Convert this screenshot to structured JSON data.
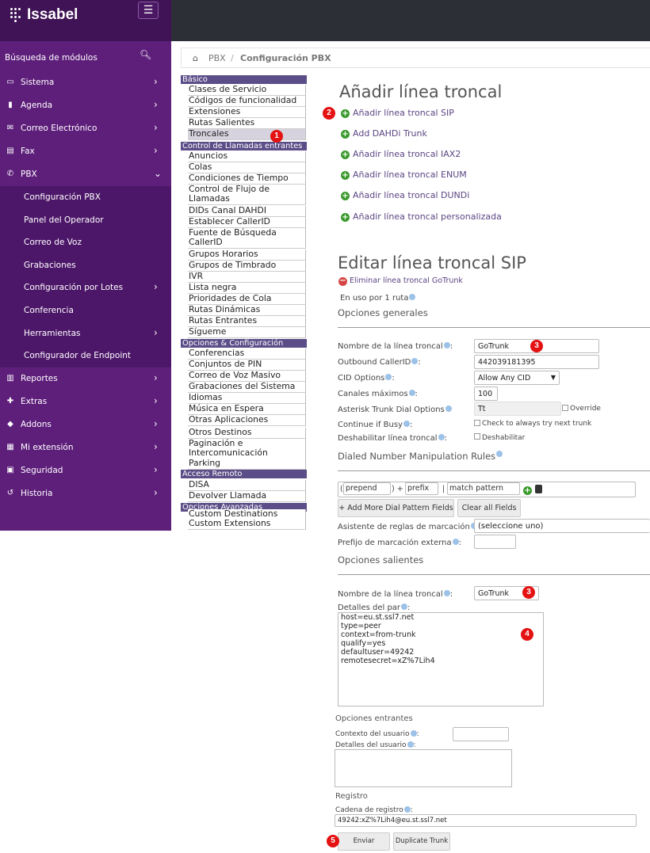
{
  "app": {
    "brand": "Issabel"
  },
  "sidebar": {
    "search_label": "Búsqueda de módulos",
    "items": [
      {
        "label": "Sistema",
        "icon": "laptop-icon"
      },
      {
        "label": "Agenda",
        "icon": "book-icon"
      },
      {
        "label": "Correo Electrónico",
        "icon": "envelope-icon"
      },
      {
        "label": "Fax",
        "icon": "printer-icon"
      },
      {
        "label": "PBX",
        "icon": "phone-icon"
      },
      {
        "label": "Reportes",
        "icon": "bar-chart-icon"
      },
      {
        "label": "Extras",
        "icon": "plus-icon"
      },
      {
        "label": "Addons",
        "icon": "cubes-icon"
      },
      {
        "label": "Mi extensión",
        "icon": "building-icon"
      },
      {
        "label": "Seguridad",
        "icon": "lock-icon"
      },
      {
        "label": "Historia",
        "icon": "history-icon"
      }
    ],
    "pbx_sub": [
      "Configuración PBX",
      "Panel del Operador",
      "Correo de Voz",
      "Grabaciones",
      "Configuración por Lotes",
      "Conferencia",
      "Herramientas",
      "Configurador de Endpoint"
    ]
  },
  "breadcrumb": {
    "c1": "PBX",
    "c2": "Configuración PBX"
  },
  "menu": {
    "h_basic": "Básico",
    "basic": [
      "Clases de Servicio",
      "Códigos de funcionalidad",
      "Extensiones",
      "Rutas Salientes",
      "Troncales"
    ],
    "h_incoming": "Control de Llamadas entrantes",
    "incoming": [
      "Anuncios",
      "Colas",
      "Condiciones de Tiempo",
      "Control de Flujo de Llamadas",
      "DIDs Canal DAHDI",
      "Establecer CallerID",
      "Fuente de Búsqueda CallerID",
      "Grupos Horarios",
      "Grupos de Timbrado",
      "IVR",
      "Lista negra",
      "Prioridades de Cola",
      "Rutas Dinámicas",
      "Rutas Entrantes",
      "Sígueme"
    ],
    "h_options": "Opciones & Configuración",
    "options": [
      "Conferencias",
      "Conjuntos de PIN",
      "Correo de Voz Masivo",
      "Grabaciones del Sistema",
      "Idiomas",
      "Música en Espera",
      "Otras Aplicaciones",
      "Otros Destinos",
      "Paginación e Intercomunicación",
      "Parking"
    ],
    "h_remote": "Acceso Remoto",
    "remote": [
      "DISA",
      "Devolver Llamada"
    ],
    "h_advanced": "Opciones Avanzadas",
    "advanced": [
      "Custom Destinations",
      "Custom Extensions"
    ]
  },
  "add": {
    "title": "Añadir línea troncal",
    "links": [
      "Añadir línea troncal SIP",
      "Add DAHDi Trunk",
      "Añadir línea troncal IAX2",
      "Añadir línea troncal ENUM",
      "Añadir línea troncal DUNDi",
      "Añadir línea troncal personalizada"
    ]
  },
  "edit": {
    "title": "Editar línea troncal SIP",
    "delete_link": "Eliminar línea troncal GoTrunk",
    "in_use": "En uso por 1 ruta",
    "general": "Opciones generales",
    "trunk_name_label": "Nombre de la línea troncal",
    "trunk_name": "GoTrunk",
    "callerid_label": "Outbound CallerID",
    "callerid": "442039181395",
    "cid_label": "CID Options",
    "cid_value": "Allow Any CID",
    "maxchan_label": "Canales máximos",
    "maxchan": "100",
    "dialopts_label": "Asterisk Trunk Dial Options",
    "dialopts": "Tt",
    "override": "Override",
    "busy_label": "Continue if Busy",
    "busy_text": "Check to always try next trunk",
    "disable_label": "Deshabilitar línea troncal",
    "disable_text": "Deshabilitar",
    "dial_rules": "Dialed Number Manipulation Rules",
    "prepend_ph": "prepend",
    "prefix_ph": "prefix",
    "pattern_ph": "match pattern",
    "add_more": "+ Add More Dial Pattern Fields",
    "clear_all": "Clear all Fields",
    "wizard_label": "Asistente de reglas de marcación",
    "wizard_value": "(seleccione uno)",
    "ext_prefix_label": "Prefijo de marcación externa",
    "outgoing": "Opciones salientes",
    "out_name_label": "Nombre de la línea troncal",
    "out_name": "GoTrunk",
    "peer_label": "Detalles del par",
    "peer_details": "host=eu.st.ssl7.net\ntype=peer\ncontext=from-trunk\nqualify=yes\ndefaultuser=49242\nremotesecret=xZ%7Lih4",
    "incoming": "Opciones entrantes",
    "user_ctx_label": "Contexto del usuario",
    "user_det_label": "Detalles del usuario",
    "registro": "Registro",
    "reg_label": "Cadena de registro",
    "reg_value": "49242:xZ%7Lih4@eu.st.ssl7.net",
    "submit": "Enviar cambios",
    "duplicate": "Duplicate Trunk"
  },
  "badges": [
    "1",
    "2",
    "3",
    "3",
    "4",
    "5"
  ],
  "colors": {
    "sidebar": "#5e1f7b",
    "topbar": "#2c2f36",
    "menu_header": "#5b4d87",
    "badge": "#e41212",
    "link": "#5b4583"
  }
}
